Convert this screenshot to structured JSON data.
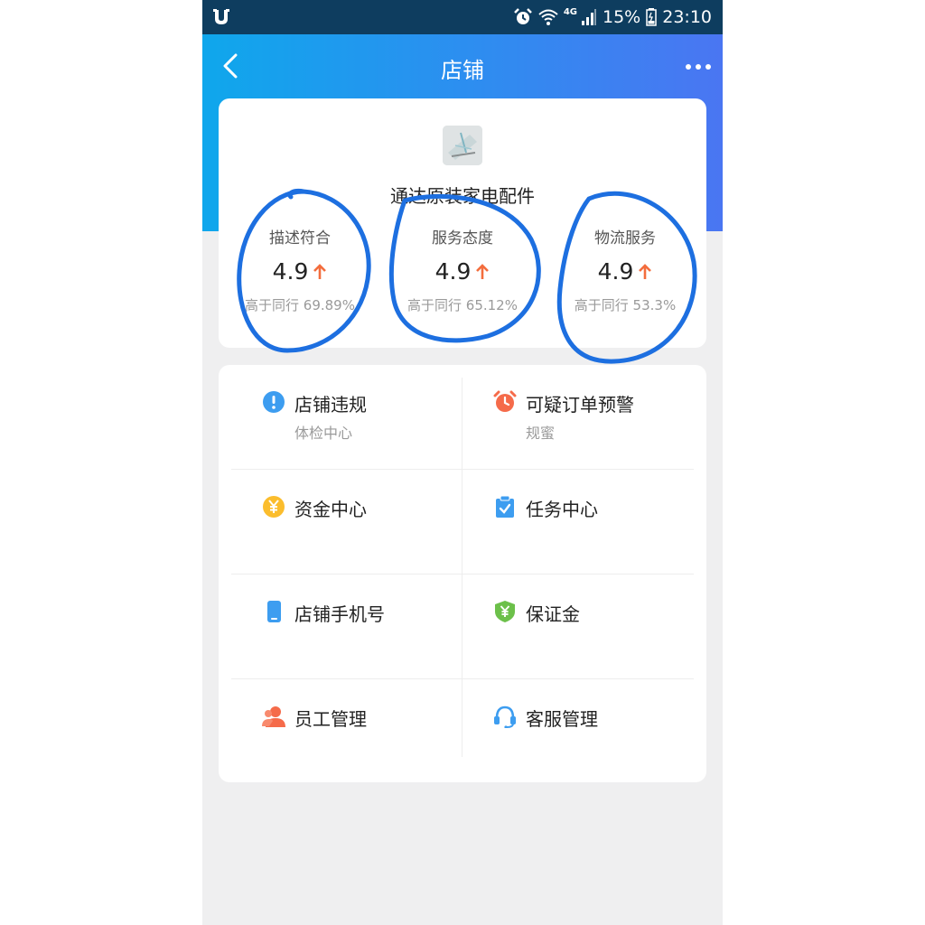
{
  "status_bar": {
    "network": "4G",
    "battery": "15%",
    "time": "23:10"
  },
  "header": {
    "title": "店铺"
  },
  "shop": {
    "name": "通达原装家电配件",
    "ratings": [
      {
        "label": "描述符合",
        "score": "4.9",
        "compare": "高于同行 69.89%"
      },
      {
        "label": "服务态度",
        "score": "4.9",
        "compare": "高于同行 65.12%"
      },
      {
        "label": "物流服务",
        "score": "4.9",
        "compare": "高于同行 53.3%"
      }
    ]
  },
  "menu": {
    "items": [
      {
        "title": "店铺违规",
        "subtitle": "体检中心",
        "icon": "exclamation-icon",
        "color": "#3d9df0"
      },
      {
        "title": "可疑订单预警",
        "subtitle": "规蜜",
        "icon": "alarm-clock-icon",
        "color": "#f56b4a"
      },
      {
        "title": "资金中心",
        "subtitle": "",
        "icon": "yen-coin-icon",
        "color": "#fbbd2d"
      },
      {
        "title": "任务中心",
        "subtitle": "",
        "icon": "clipboard-check-icon",
        "color": "#3d9df0"
      },
      {
        "title": "店铺手机号",
        "subtitle": "",
        "icon": "phone-icon",
        "color": "#3d9df0"
      },
      {
        "title": "保证金",
        "subtitle": "",
        "icon": "yen-shield-icon",
        "color": "#6cc04a"
      },
      {
        "title": "员工管理",
        "subtitle": "",
        "icon": "staff-icon",
        "color": "#f56b4a"
      },
      {
        "title": "客服管理",
        "subtitle": "",
        "icon": "headset-icon",
        "color": "#3d9df0"
      }
    ]
  },
  "colors": {
    "header_gradient_start": "#0fa7ec",
    "header_gradient_end": "#4a76f2",
    "up_arrow": "#f36d3d",
    "annotation_ink": "#1d6fe0"
  }
}
